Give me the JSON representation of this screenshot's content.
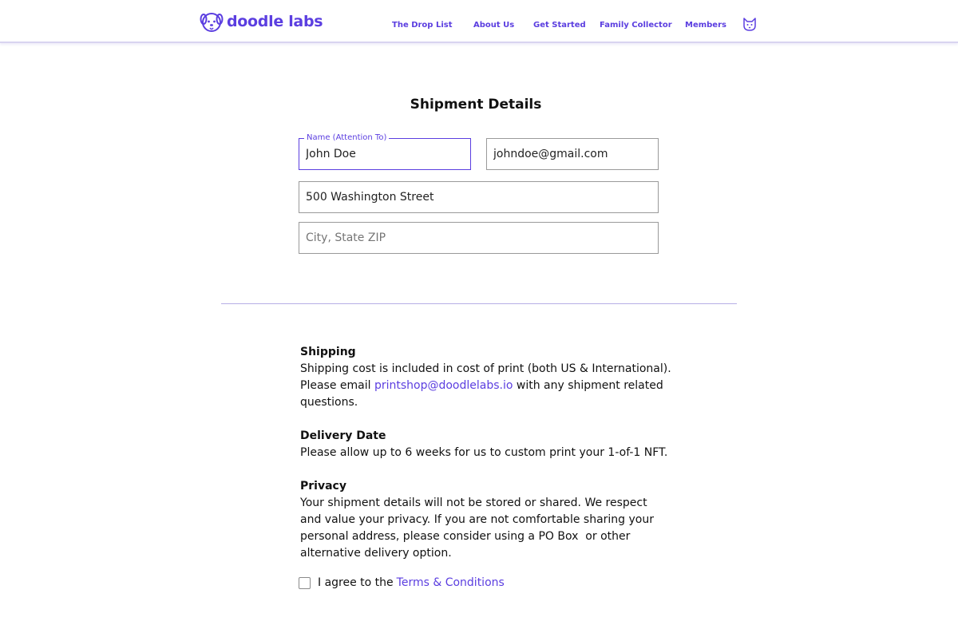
{
  "brand": {
    "name": "doodle labs",
    "color": "#5b3ee0"
  },
  "nav": {
    "items": [
      {
        "label": "The Drop List"
      },
      {
        "label": "About Us"
      },
      {
        "label": "Get Started"
      },
      {
        "label": "Family Collector"
      },
      {
        "label": "Members"
      }
    ],
    "profile_icon": "cat-face-icon"
  },
  "form": {
    "title": "Shipment Details",
    "name": {
      "label": "Name (Attention To)",
      "value": "John Doe"
    },
    "email": {
      "value": "johndoe@gmail.com"
    },
    "street": {
      "value": "500 Washington Street"
    },
    "city": {
      "placeholder": "City, State ZIP"
    }
  },
  "info": {
    "shipping": {
      "heading": "Shipping",
      "line1": "Shipping cost is included in cost of print (both US & International).",
      "line2_prefix": "Please email ",
      "email_link": "printshop@doodlelabs.io",
      "line2_suffix": " with any shipment related questions."
    },
    "delivery": {
      "heading": "Delivery Date",
      "text": "Please allow up to 6 weeks for us to custom print your 1-of-1 NFT."
    },
    "privacy": {
      "heading": "Privacy",
      "text": "Your shipment details will not be stored or shared. We respect and value your privacy. If you are not comfortable sharing your personal address, please consider using a PO Box  or other alternative delivery option."
    }
  },
  "agreement": {
    "checked": false,
    "prefix": "I agree to the",
    "link": "Terms & Conditions"
  }
}
